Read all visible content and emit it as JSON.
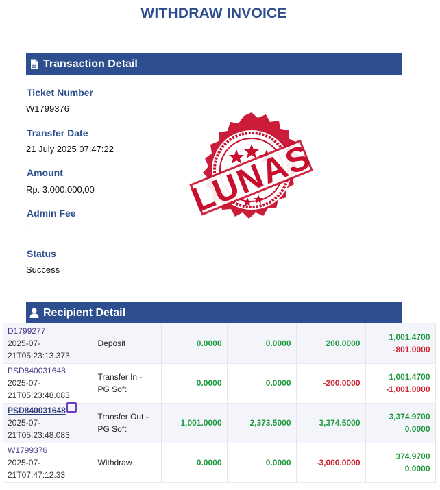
{
  "page": {
    "title": "WITHDRAW INVOICE"
  },
  "transaction": {
    "heading": "Transaction Detail",
    "icon": "document-icon",
    "ticket_label": "Ticket Number",
    "ticket_value": "W1799376",
    "date_label": "Transfer Date",
    "date_value": "21 July 2025 07:47:22",
    "amount_label": "Amount",
    "amount_value": "Rp. 3.000.000,00",
    "fee_label": "Admin Fee",
    "fee_value": "-",
    "status_label": "Status",
    "status_value": "Success"
  },
  "stamp": {
    "text": "LUNAS",
    "color": "#c8102e"
  },
  "recipient": {
    "heading": "Recipient Detail",
    "icon": "user-icon"
  },
  "ledger": {
    "rows": [
      {
        "ref": "D1799277",
        "time_a": "2025-07-",
        "time_b": "21T05:23:13.373",
        "type": "Deposit",
        "c1": "0.0000",
        "c2": "0.0000",
        "c3": "200.0000",
        "bal1": "1,001.4700",
        "bal2": "-801.0000"
      },
      {
        "ref": "PSD840031648",
        "time_a": "2025-07-",
        "time_b": "21T05:23:48.083",
        "type": "Transfer In - PG Soft",
        "c1": "0.0000",
        "c2": "0.0000",
        "c3": "-200.0000",
        "bal1": "1,001.4700",
        "bal2": "-1,001.0000"
      },
      {
        "ref": "PSD840031648",
        "time_a": "2025-07-",
        "time_b": "21T05:23:48.083",
        "type": "Transfer Out - PG Soft",
        "c1": "1,001.0000",
        "c2": "2,373.5000",
        "c3": "3,374.5000",
        "bal1": "3,374.9700",
        "bal2": "0.0000"
      },
      {
        "ref": "W1799376",
        "time_a": "2025-07-",
        "time_b": "21T07:47:12.33",
        "type": "Withdraw",
        "c1": "0.0000",
        "c2": "0.0000",
        "c3": "-3,000.0000",
        "bal1": "374.9700",
        "bal2": "0.0000"
      }
    ]
  }
}
